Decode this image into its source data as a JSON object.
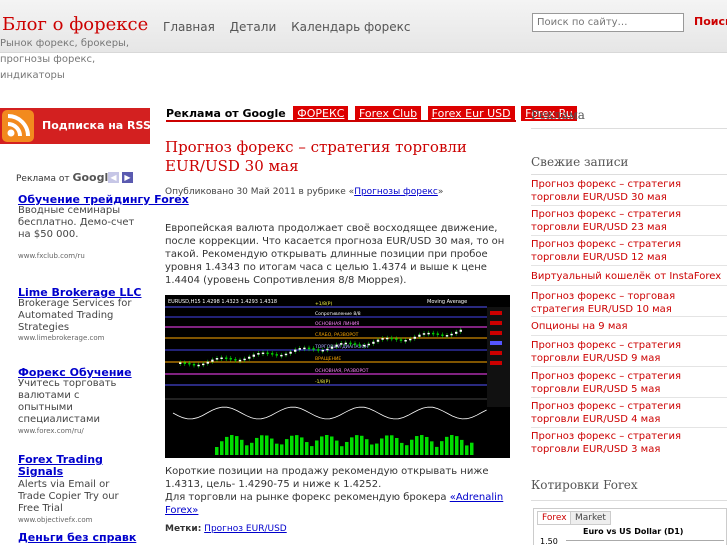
{
  "site": {
    "title": "Блог о форексе",
    "description": "Рынок форекс, брокеры, прогнозы форекс, индикаторы"
  },
  "nav": [
    "Главная",
    "Детали",
    "Календарь форекс"
  ],
  "search": {
    "placeholder": "Поиск по сайту…",
    "button": "Поиск"
  },
  "rss": {
    "label": "Подписка на RSS"
  },
  "left_ads": {
    "header_text": "Реклама от",
    "header_brand": "Google",
    "items": [
      {
        "title": "Обучение трейдингу Forex",
        "body": "Вводные семинары бесплатно. Демо-счет на $50 000.",
        "url": "www.fxclub.com/ru"
      },
      {
        "title": "Lime Brokerage LLC",
        "body": "Brokerage Services for Automated Trading Strategies",
        "url": "www.limebrokerage.com"
      },
      {
        "title": "Форекс Обучение",
        "body": "Учитесь торговать валютами с опытными специалистами",
        "url": "www.forex.com/ru/"
      },
      {
        "title": "Forex Trading Signals",
        "body": "Alerts via Email or Trade Copier Try our Free Trial",
        "url": "www.objectivefx.com"
      },
      {
        "title": "Деньги без справк",
        "body": "",
        "url": ""
      }
    ]
  },
  "google_bar": {
    "label": "Реклама от Google",
    "links": [
      "ФОРЕКС",
      "Forex Club",
      "Forex Eur USD",
      "Forex Ru"
    ]
  },
  "post": {
    "title": "Прогноз форекс – стратегия торговли EUR/USD 30 мая",
    "meta_prefix": "Опубликовано 30 Май 2011 в рубрике «",
    "meta_category": "Прогнозы форекс",
    "meta_suffix": "»",
    "body": "Европейская валюта продолжает своё восходящее движение, после коррекции. Что касается прогноза EUR/USD 30 мая, то он такой. Рекомендую открывать длинные позиции при пробое уровня 1.4343 по итогам часа с целью 1.4374 и выше к цене 1.4404 (уровень Сопротивления 8/8 Мюррея).",
    "footer_line1": "Короткие позиции на продажу рекомендую открывать ниже 1.4313, цель- 1.4290-75 и ниже к 1.4252.",
    "footer_line2": "Для торговли на рынке форекс рекомендую брокера ",
    "footer_link": "«Adrenalin Forex»",
    "tags_label": "Метки:",
    "tags_link": "Прогноз EUR/USD"
  },
  "chart_image": {
    "header": "EURUSD,H15  1.4298  1.4323  1.4293  1.4318",
    "top_right": "Moving Average",
    "levels": [
      "+1/8(Р)",
      "Сопротивление 8/8",
      "ОСНОВНАЯ ЛИНИЯ",
      "СЛАБО, РАЗВОРОТ",
      "ТОРГОВЫЙ ДИАПАЗОН",
      "ВРАЩЕНИЕ",
      "ОСНОВНАЯ, РАЗВОРОТ",
      "-1/8(Р)"
    ]
  },
  "sidebar": {
    "ad_title": "Реклама",
    "recent_title": "Свежие записи",
    "recent_posts": [
      "Прогноз форекс – стратегия торговли EUR/USD 30 мая",
      "Прогноз форекс – стратегия торговли EUR/USD 23 мая",
      "Прогноз форекс – стратегия торговли EUR/USD 12 мая",
      "Виртуальный кошелёк от InstaForex",
      "Прогноз форекс – торговая стратегия EUR/USD 10 мая",
      "Опционы на 9 мая",
      "Прогноз форекс – стратегия торговли EUR/USD 9 мая",
      "Прогноз форекс – стратегия торговли EUR/USD 5 мая",
      "Прогноз форекс – стратегия торговли EUR/USD 4 мая",
      "Прогноз форекс – стратегия торговли EUR/USD 3 мая"
    ],
    "quotes_title": "Котировки Forex",
    "quotes_tabs": [
      "Forex",
      "Market"
    ],
    "quotes_chart_title": "Euro vs US Dollar (D1)",
    "quotes_y_label": "1.50"
  }
}
